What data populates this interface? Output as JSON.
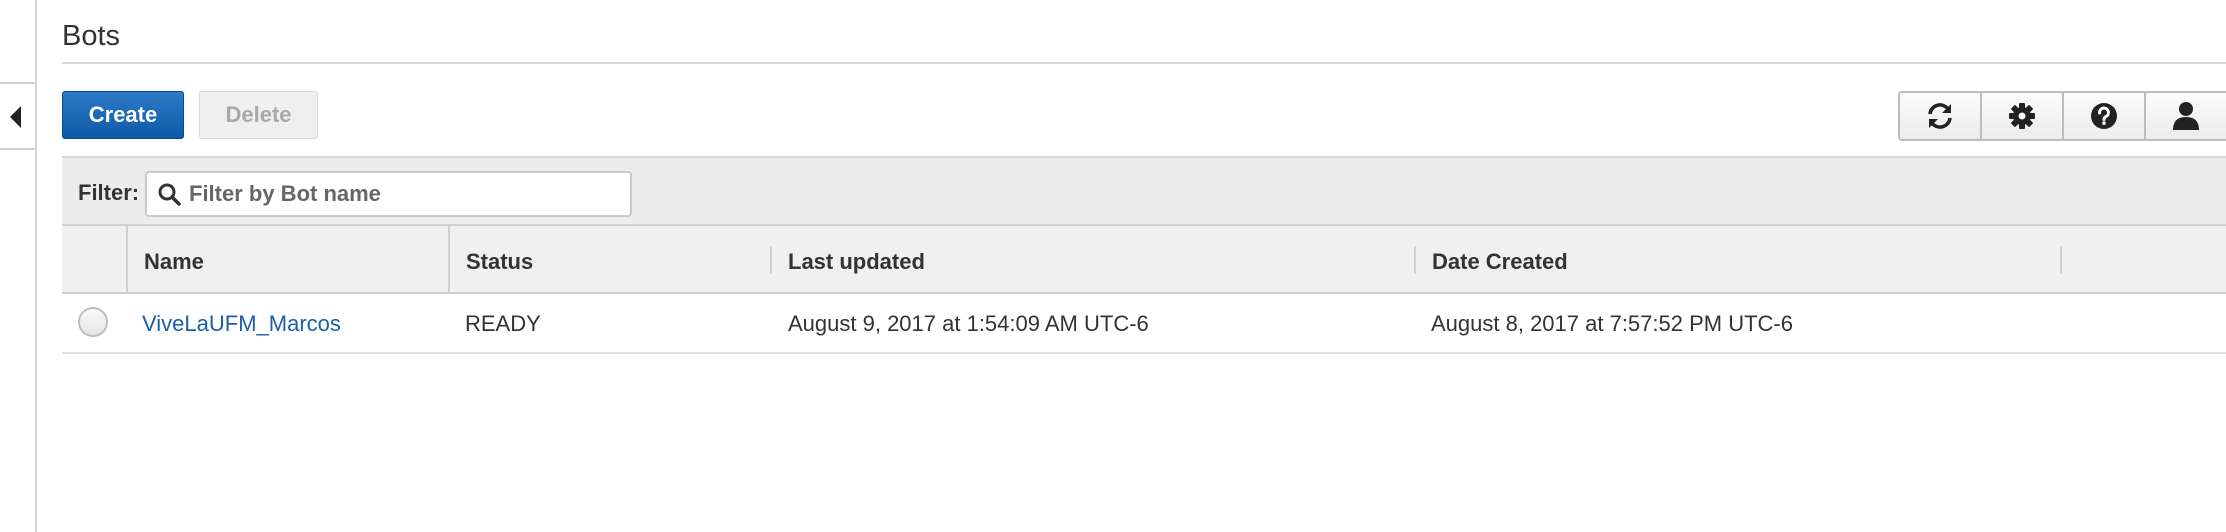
{
  "page": {
    "title": "Bots"
  },
  "sidebar": {
    "collapse_icon": "caret-left-icon"
  },
  "toolbar": {
    "create_label": "Create",
    "delete_label": "Delete",
    "icons": [
      "refresh-icon",
      "gear-icon",
      "help-icon",
      "user-icon"
    ],
    "accent_color": "#1a66b4"
  },
  "filter": {
    "label": "Filter:",
    "placeholder": "Filter by Bot name",
    "value": ""
  },
  "table": {
    "columns": [
      "Name",
      "Status",
      "Last updated",
      "Date Created"
    ],
    "rows": [
      {
        "name": "ViveLaUFM_Marcos",
        "status": "READY",
        "last_updated": "August 9, 2017 at 1:54:09 AM UTC-6",
        "date_created": "August 8, 2017 at 7:57:52 PM UTC-6"
      }
    ]
  }
}
